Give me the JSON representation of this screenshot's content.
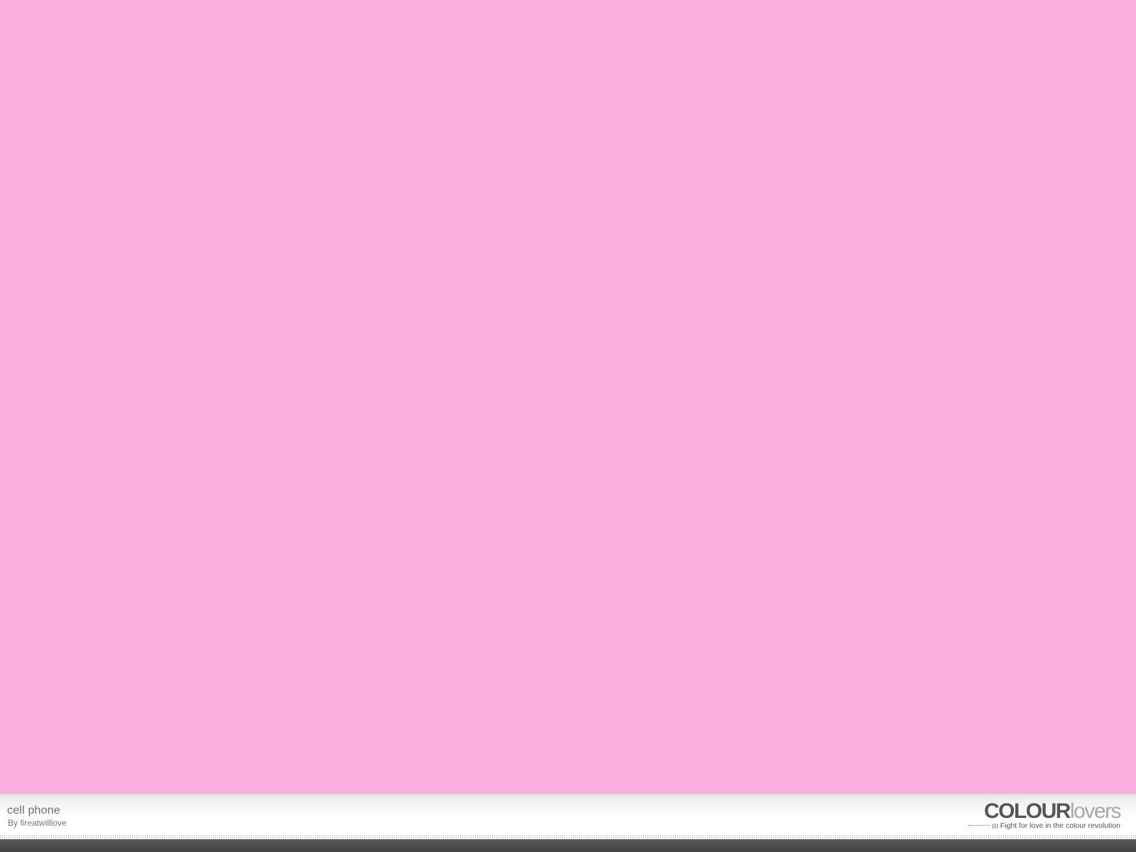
{
  "palette": {
    "swatch_color": "#f9b0de",
    "title": "cell phone",
    "author": "By fireatwilllove"
  },
  "branding": {
    "logo_strong": "COLOUR",
    "logo_light": "lovers",
    "tagline": "Fight for love in the colour revolution"
  }
}
